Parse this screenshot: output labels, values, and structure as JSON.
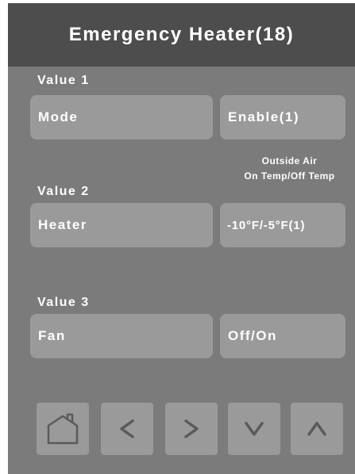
{
  "header": {
    "title": "Emergency Heater(18)"
  },
  "rows": [
    {
      "label": "Value 1",
      "name": "Mode",
      "value": "Enable(1)"
    },
    {
      "label": "Value 2",
      "name": "Heater",
      "value": "-10°F/-5°F(1)"
    },
    {
      "label": "Value 3",
      "name": "Fan",
      "value": "Off/On"
    }
  ],
  "note": {
    "line1": "Outside Air",
    "line2": "On Temp/Off Temp"
  },
  "nav": {
    "icons": [
      "home-icon",
      "chevron-left-icon",
      "chevron-right-icon",
      "chevron-down-icon",
      "chevron-up-icon"
    ]
  },
  "colors": {
    "panel": "#7b7b7b",
    "title_bar": "#4d4d4d",
    "button": "#9a9a9a",
    "text": "#ffffff",
    "icon": "#5a5a5a"
  }
}
